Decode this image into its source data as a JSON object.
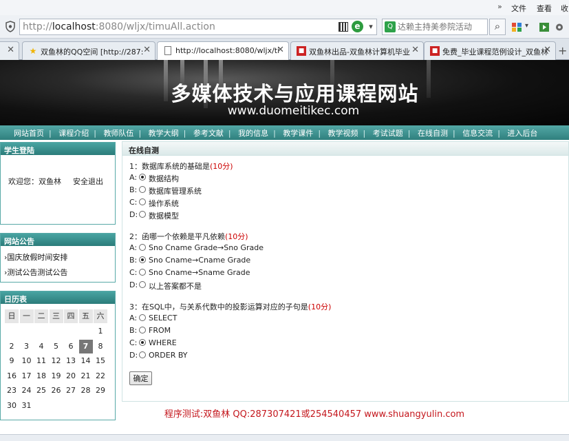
{
  "menubar": {
    "chevron": "»",
    "items": [
      "文件",
      "查看",
      "收"
    ]
  },
  "address": {
    "scheme": "http://",
    "host": "localhost",
    "rest": ":8080/wljx/timuAll.action",
    "qr_icon": "qr-code-icon",
    "engine_badge": "e"
  },
  "search": {
    "placeholder": "达赖主持美参院活动",
    "engine_icon": "search-engine-icon",
    "button_icon": "magnifier-icon"
  },
  "tabs": [
    {
      "label": "双鱼林的QQ空间 [http://287:",
      "icon": "star-icon",
      "active": false
    },
    {
      "label": "http://localhost:8080/wljx/ti",
      "icon": "page-icon",
      "active": true
    },
    {
      "label": "双鱼林出品-双鱼林计算机毕业",
      "icon": "site-icon",
      "active": false
    },
    {
      "label": "免费_毕业课程范例设计_双鱼林",
      "icon": "site-icon",
      "active": false
    }
  ],
  "banner": {
    "title": "多媒体技术与应用课程网站",
    "subtitle": "www.duomeitikec.com"
  },
  "nav": [
    "网站首页",
    "课程介绍",
    "教师队伍",
    "教学大纲",
    "参考文献",
    "我的信息",
    "教学课件",
    "教学视频",
    "考试试题",
    "在线自测",
    "信息交流",
    "进入后台"
  ],
  "login": {
    "title": "学生登陆",
    "welcome": "欢迎您：双鱼林",
    "logout": "安全退出"
  },
  "notice": {
    "title": "网站公告",
    "items": [
      "国庆放假时间安排",
      "测试公告测试公告"
    ]
  },
  "calendar": {
    "title": "日历表",
    "weekdays": [
      "日",
      "一",
      "二",
      "三",
      "四",
      "五",
      "六"
    ],
    "today": "7",
    "rows": [
      [
        "",
        "",
        "",
        "",
        "",
        "",
        "1"
      ],
      [
        "2",
        "3",
        "4",
        "5",
        "6",
        "7",
        "8"
      ],
      [
        "9",
        "10",
        "11",
        "12",
        "13",
        "14",
        "15"
      ],
      [
        "16",
        "17",
        "18",
        "19",
        "20",
        "21",
        "22"
      ],
      [
        "23",
        "24",
        "25",
        "26",
        "27",
        "28",
        "29"
      ],
      [
        "30",
        "31",
        "",
        "",
        "",
        "",
        ""
      ]
    ]
  },
  "quiz": {
    "title": "在线自测",
    "questions": [
      {
        "text": "1：数据库系统的基础是",
        "score": "(10分)",
        "selected": 0,
        "options": [
          {
            "letter": "A:",
            "text": "数据结构"
          },
          {
            "letter": "B:",
            "text": "数据库管理系统"
          },
          {
            "letter": "C:",
            "text": "操作系统"
          },
          {
            "letter": "D:",
            "text": "数据模型"
          }
        ]
      },
      {
        "text": "2：函哪一个依赖是平凡依赖",
        "score": "(10分)",
        "selected": 1,
        "options": [
          {
            "letter": "A:",
            "text": "Sno Cname Grade→Sno Grade"
          },
          {
            "letter": "B:",
            "text": "Sno Cname→Cname Grade"
          },
          {
            "letter": "C:",
            "text": "Sno Cname→Sname Grade"
          },
          {
            "letter": "D:",
            "text": "以上答案都不是"
          }
        ]
      },
      {
        "text": "3：在SQL中，与关系代数中的投影运算对应的子句是",
        "score": "(10分)",
        "selected": 2,
        "options": [
          {
            "letter": "A:",
            "text": "SELECT"
          },
          {
            "letter": "B:",
            "text": "FROM"
          },
          {
            "letter": "C:",
            "text": "WHERE"
          },
          {
            "letter": "D:",
            "text": "ORDER BY"
          }
        ]
      }
    ],
    "submit": "确定"
  },
  "footer": "程序测试:双鱼林 QQ:287307421或254540457 www.shuangyulin.com"
}
